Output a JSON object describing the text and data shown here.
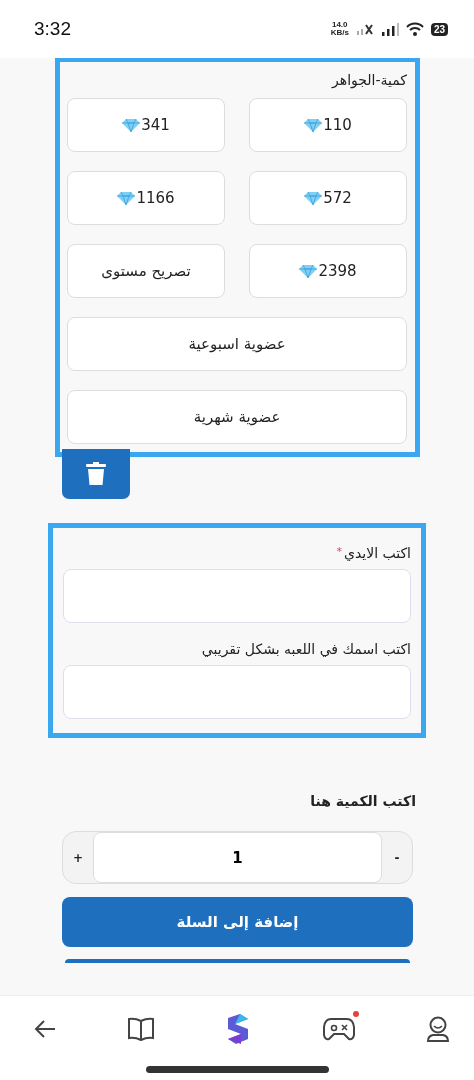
{
  "status_bar": {
    "time": "3:32",
    "net_speed": "14.0",
    "net_unit": "KB/s",
    "battery": "23"
  },
  "gems_card": {
    "title": "كمية-الجواهر",
    "options": [
      {
        "kind": "gem",
        "label": "110",
        "selected": false
      },
      {
        "kind": "gem",
        "label": "341",
        "selected": false
      },
      {
        "kind": "gem",
        "label": "572",
        "selected": false
      },
      {
        "kind": "gem",
        "label": "1166",
        "selected": false
      },
      {
        "kind": "gem",
        "label": "2398",
        "selected": false
      },
      {
        "kind": "plain",
        "label": "تصريح مستوى",
        "selected": false
      },
      {
        "kind": "wide",
        "label": "عضوية اسبوعية",
        "selected": false
      },
      {
        "kind": "wide",
        "label": "عضوية شهرية",
        "selected": false
      }
    ]
  },
  "player_card": {
    "fields": [
      {
        "label": "اكتب الايدي",
        "required_mark": "*"
      },
      {
        "label": "اكتب اسمك في اللعبه بشكل تقريبي"
      }
    ]
  },
  "quantity": {
    "label": "اكتب الكمية هنا",
    "plus": "+",
    "value": "1",
    "minus": "-"
  },
  "add_to_cart": "إضافة إلى السلة",
  "nav": {
    "notification_dot": true
  }
}
